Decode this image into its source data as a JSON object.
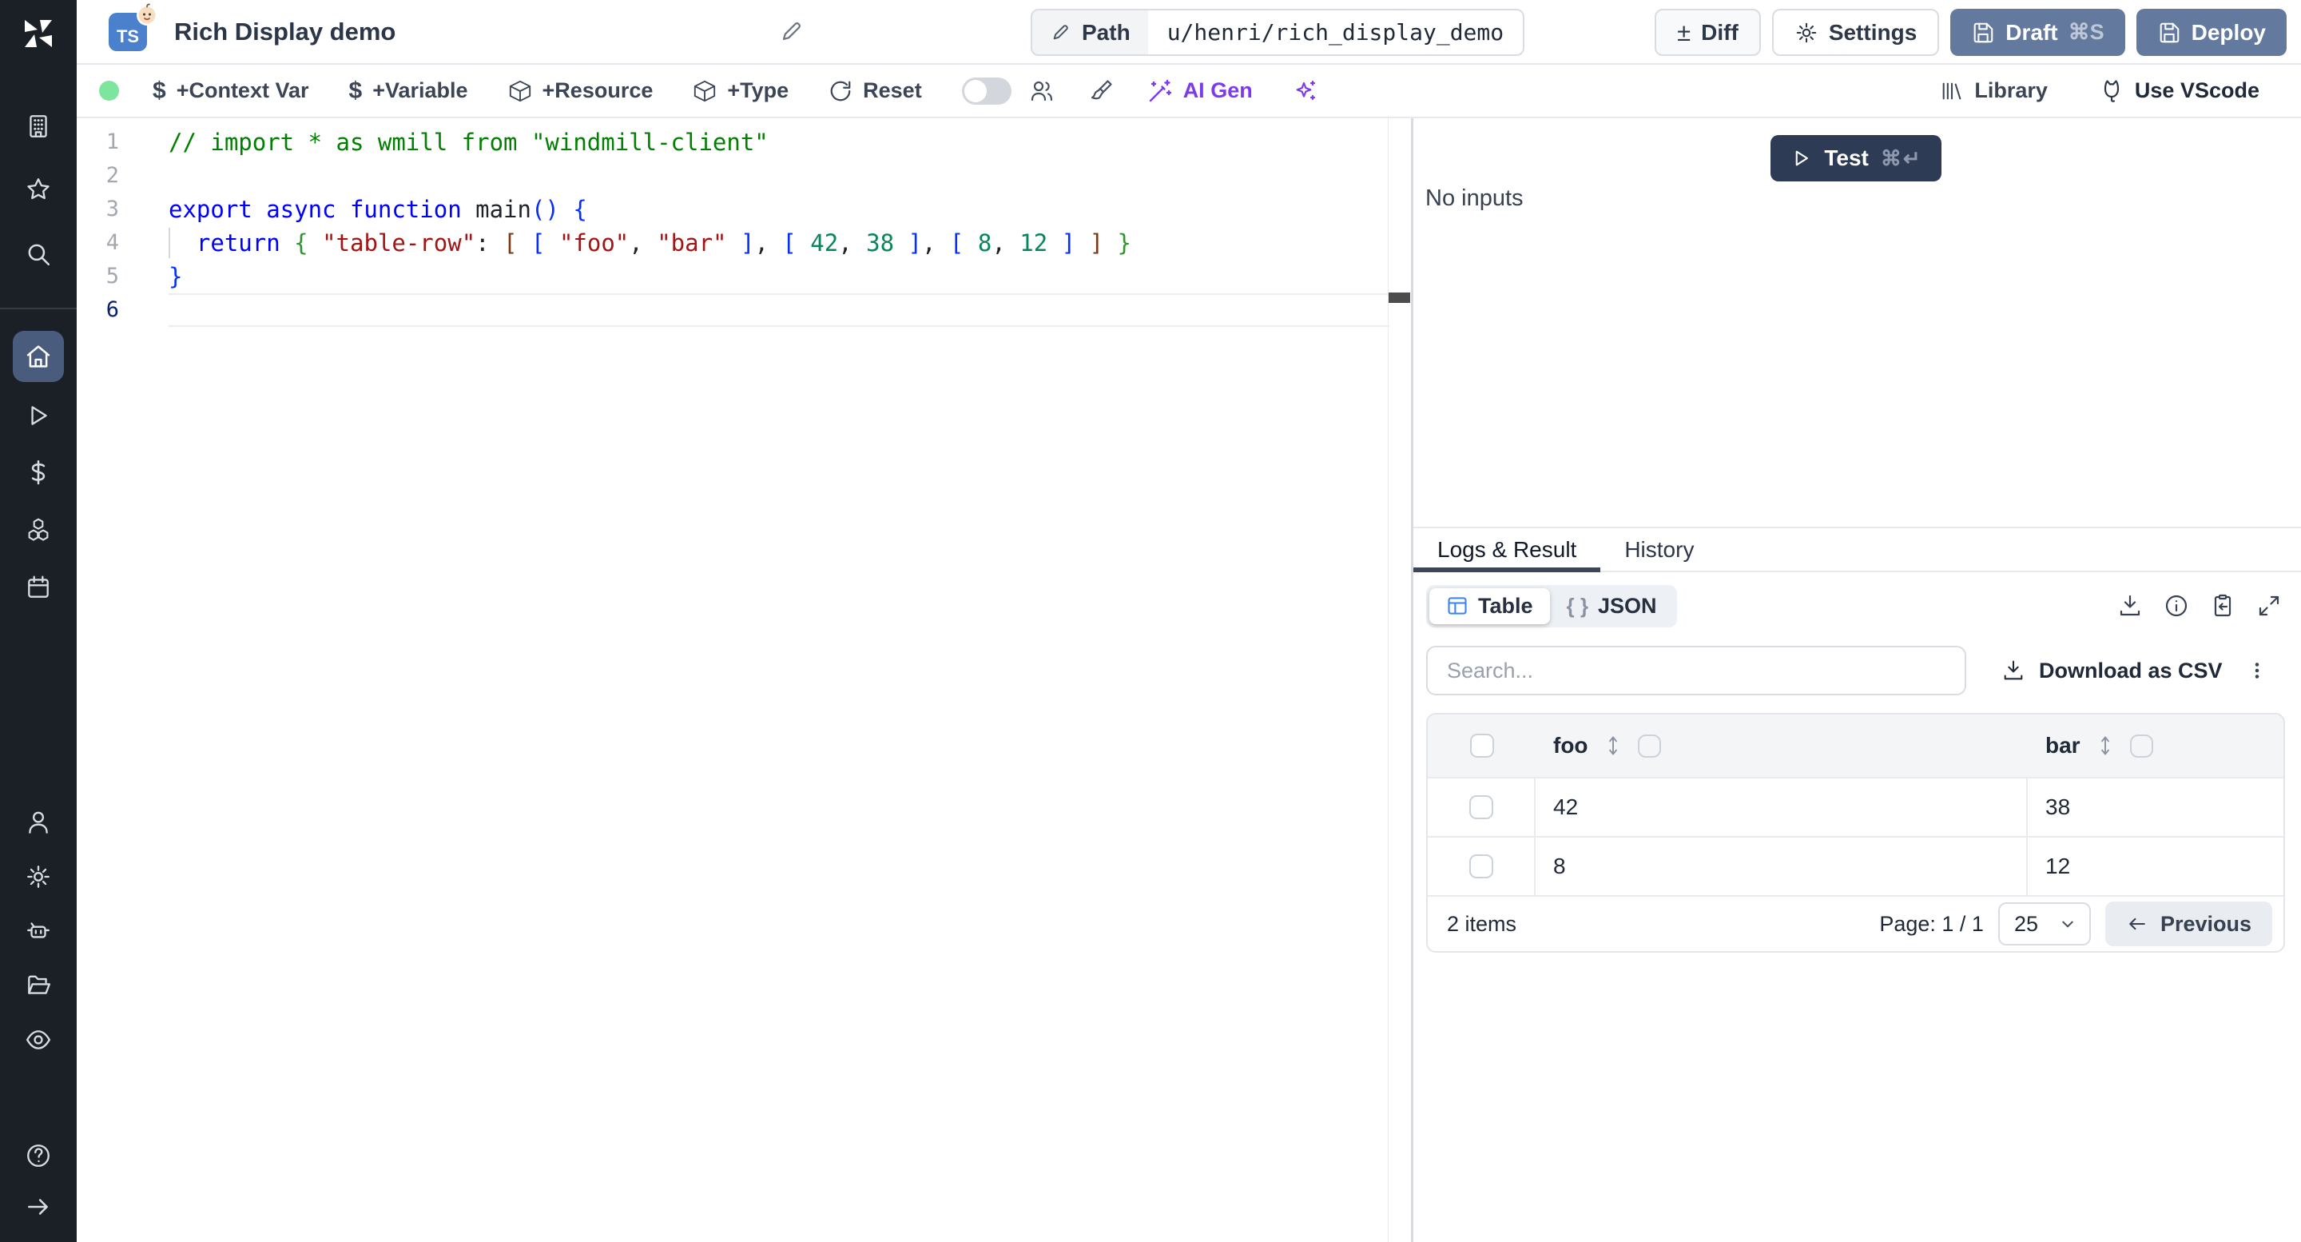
{
  "header": {
    "title": "Rich Display demo",
    "lang_badge": "TS",
    "path": {
      "label": "Path",
      "value": "u/henri/rich_display_demo"
    },
    "buttons": {
      "diff": "Diff",
      "settings": "Settings",
      "draft": "Draft",
      "draft_kbd": "⌘S",
      "deploy": "Deploy"
    }
  },
  "toolbar": {
    "context_var": "+Context Var",
    "variable": "+Variable",
    "resource": "+Resource",
    "type": "+Type",
    "reset": "Reset",
    "ai_gen": "AI Gen",
    "library": "Library",
    "vscode": "Use VScode"
  },
  "editor": {
    "lines": [
      {
        "num": "1",
        "tokens": [
          {
            "t": "// import * as wmill from \"windmill-client\"",
            "c": "comment"
          }
        ]
      },
      {
        "num": "2",
        "tokens": []
      },
      {
        "num": "3",
        "tokens": [
          {
            "t": "export async function",
            "c": "keyword"
          },
          {
            "t": " main",
            "c": "plain"
          },
          {
            "t": "() {",
            "c": "b1"
          }
        ]
      },
      {
        "num": "4",
        "guide": true,
        "tokens": [
          {
            "t": "  ",
            "c": "plain"
          },
          {
            "t": "return",
            "c": "keyword"
          },
          {
            "t": " ",
            "c": "plain"
          },
          {
            "t": "{",
            "c": "b2"
          },
          {
            "t": " ",
            "c": "plain"
          },
          {
            "t": "\"table-row\"",
            "c": "string"
          },
          {
            "t": ": ",
            "c": "plain"
          },
          {
            "t": "[",
            "c": "b3"
          },
          {
            "t": " ",
            "c": "plain"
          },
          {
            "t": "[",
            "c": "b1"
          },
          {
            "t": " ",
            "c": "plain"
          },
          {
            "t": "\"foo\"",
            "c": "string"
          },
          {
            "t": ", ",
            "c": "plain"
          },
          {
            "t": "\"bar\"",
            "c": "string"
          },
          {
            "t": " ",
            "c": "plain"
          },
          {
            "t": "]",
            "c": "b1"
          },
          {
            "t": ", ",
            "c": "plain"
          },
          {
            "t": "[",
            "c": "b1"
          },
          {
            "t": " ",
            "c": "plain"
          },
          {
            "t": "42",
            "c": "number"
          },
          {
            "t": ", ",
            "c": "plain"
          },
          {
            "t": "38",
            "c": "number"
          },
          {
            "t": " ",
            "c": "plain"
          },
          {
            "t": "]",
            "c": "b1"
          },
          {
            "t": ", ",
            "c": "plain"
          },
          {
            "t": "[",
            "c": "b1"
          },
          {
            "t": " ",
            "c": "plain"
          },
          {
            "t": "8",
            "c": "number"
          },
          {
            "t": ", ",
            "c": "plain"
          },
          {
            "t": "12",
            "c": "number"
          },
          {
            "t": " ",
            "c": "plain"
          },
          {
            "t": "]",
            "c": "b1"
          },
          {
            "t": " ",
            "c": "plain"
          },
          {
            "t": "]",
            "c": "b3"
          },
          {
            "t": " ",
            "c": "plain"
          },
          {
            "t": "}",
            "c": "b2"
          }
        ]
      },
      {
        "num": "5",
        "tokens": [
          {
            "t": "}",
            "c": "b1"
          }
        ]
      },
      {
        "num": "6",
        "current": true,
        "tokens": []
      }
    ]
  },
  "run_panel": {
    "test_label": "Test",
    "test_kbd": "⌘↵",
    "no_inputs": "No inputs"
  },
  "results": {
    "tabs": {
      "logs": "Logs & Result",
      "history": "History"
    },
    "view": {
      "table": "Table",
      "json_icon": "{ }",
      "json_label": "JSON"
    },
    "search_placeholder": "Search...",
    "download_csv": "Download as CSV",
    "table": {
      "columns": [
        "foo",
        "bar"
      ],
      "rows": [
        [
          "42",
          "38"
        ],
        [
          "8",
          "12"
        ]
      ],
      "items_label": "2 items",
      "page_label": "Page: 1 / 1",
      "page_size": "25",
      "previous": "Previous"
    }
  },
  "colors": {
    "sidebar_bg": "#1b1f26",
    "sidebar_active": "#4a5c7d",
    "deploy_slate": "#64799e",
    "test_navy": "#2e3b54",
    "ai_purple": "#7c3aed",
    "green_status_dot": "#7ee59e",
    "table_icon_blue": "#3b82f6",
    "ts_badge_blue": "#4a80cc",
    "code_comment": "#008000",
    "code_keyword": "#0000ff",
    "code_string": "#a31515",
    "code_number": "#098658"
  }
}
